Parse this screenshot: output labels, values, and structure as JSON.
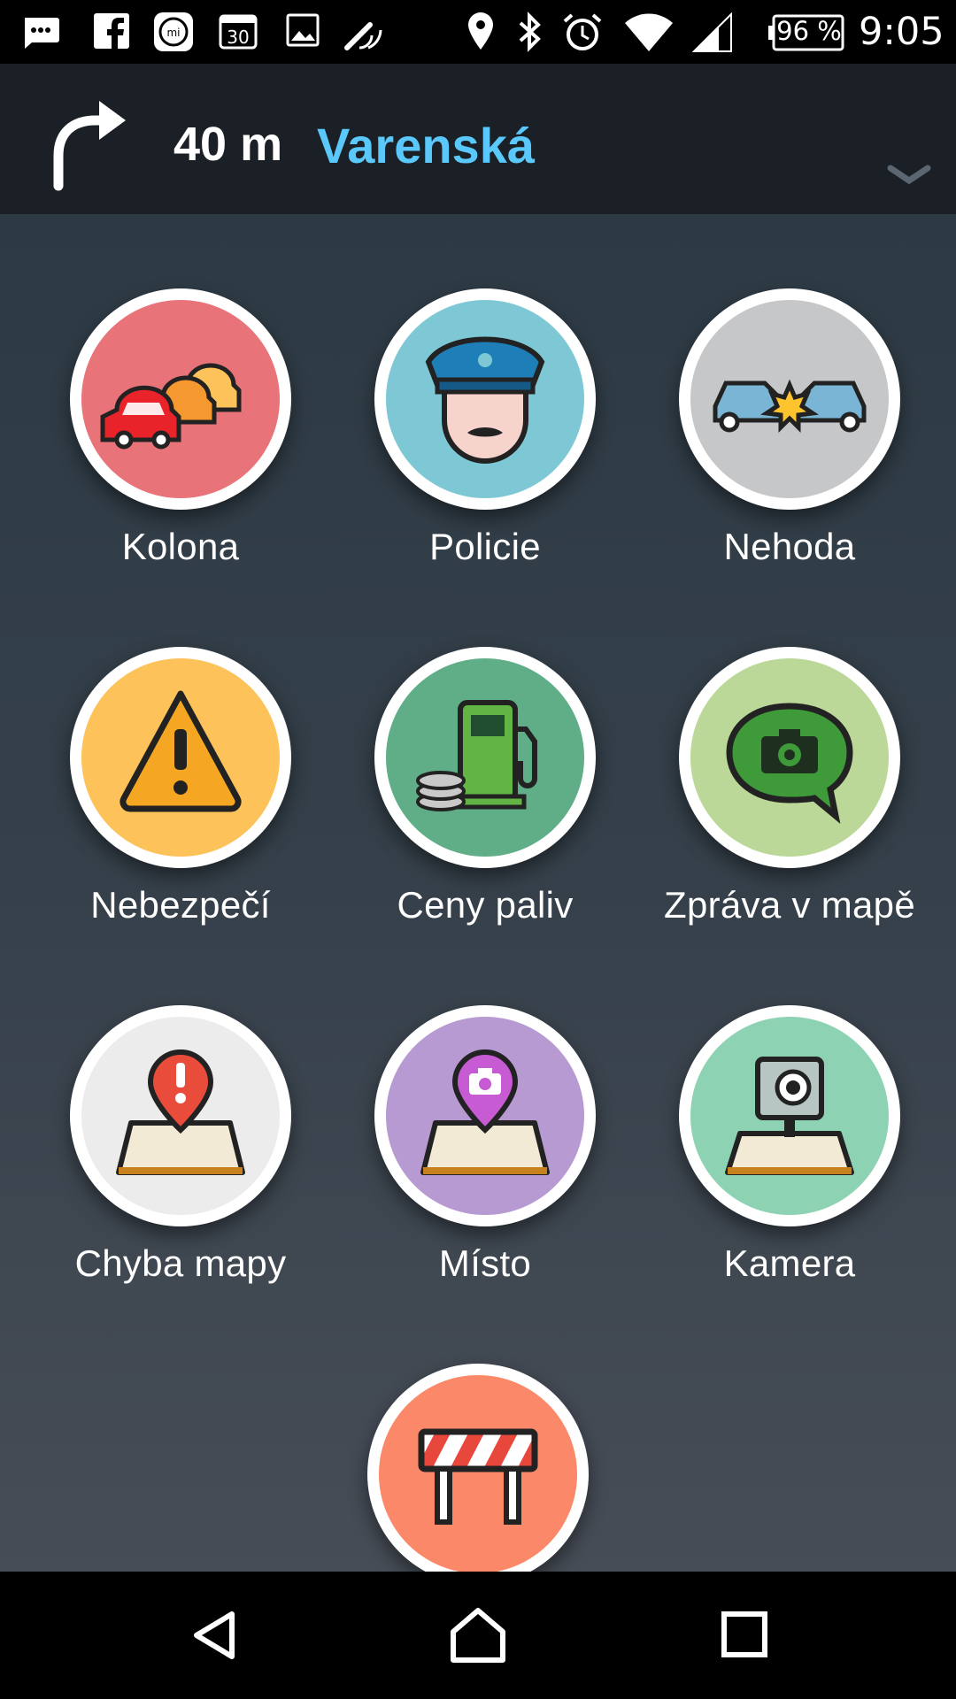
{
  "status_bar": {
    "battery": "96 %",
    "time": "9:05",
    "icons": [
      "message-icon",
      "facebook-icon",
      "mi-icon",
      "calendar-icon",
      "image-icon",
      "cast-icon",
      "location-icon",
      "bluetooth-icon",
      "alarm-icon",
      "wifi-icon",
      "signal-icon",
      "battery-icon"
    ]
  },
  "navigation": {
    "distance": "40 m",
    "street": "Varenská",
    "turn_icon": "turn-right-icon",
    "expand_icon": "chevron-down-icon"
  },
  "reports": [
    {
      "label": "Kolona",
      "icon": "traffic-jam-icon",
      "color": "#e8747a"
    },
    {
      "label": "Policie",
      "icon": "police-icon",
      "color": "#7ec8d6"
    },
    {
      "label": "Nehoda",
      "icon": "accident-icon",
      "color": "#c6c7c9"
    },
    {
      "label": "Nebezpečí",
      "icon": "hazard-icon",
      "color": "#fdc25a"
    },
    {
      "label": "Ceny paliv",
      "icon": "gas-station-icon",
      "color": "#5fae87"
    },
    {
      "label": "Zpráva v mapě",
      "icon": "map-chat-icon",
      "color": "#bcd899"
    },
    {
      "label": "Chyba mapy",
      "icon": "map-issue-icon",
      "color": "#ececec"
    },
    {
      "label": "Místo",
      "icon": "place-icon",
      "color": "#b69ad1"
    },
    {
      "label": "Kamera",
      "icon": "speed-camera-icon",
      "color": "#8ed2b4"
    },
    {
      "label": "",
      "icon": "road-closure-icon",
      "color": "#fb8969"
    }
  ],
  "bottom_nav": [
    "back-icon",
    "home-icon",
    "recents-icon"
  ]
}
